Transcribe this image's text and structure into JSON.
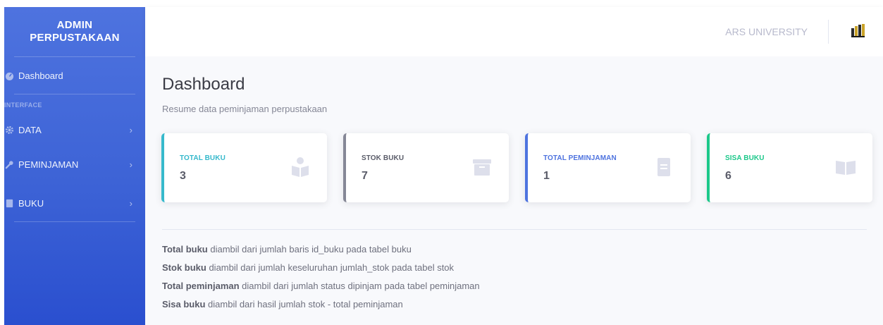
{
  "sidebar": {
    "brand_line1": "ADMIN",
    "brand_line2": "PERPUSTAKAAN",
    "dashboard_label": "Dashboard",
    "heading": "INTERFACE",
    "items": [
      {
        "label": "DATA",
        "icon": "gear-icon"
      },
      {
        "label": "PEMINJAMAN",
        "icon": "wrench-icon"
      },
      {
        "label": "BUKU",
        "icon": "book-icon"
      }
    ]
  },
  "topbar": {
    "university": "ARS UNIVERSITY",
    "logo": "university-logo"
  },
  "main": {
    "title": "Dashboard",
    "subtitle": "Resume data peminjaman perpustakaan",
    "cards": [
      {
        "label": "TOTAL BUKU",
        "value": "3",
        "accent": "#36b9cc",
        "icon": "reader-icon"
      },
      {
        "label": "STOK BUKU",
        "value": "7",
        "accent": "#858796",
        "icon": "archive-icon"
      },
      {
        "label": "TOTAL PEMINJAMAN",
        "value": "1",
        "accent": "#4e73df",
        "icon": "book-icon"
      },
      {
        "label": "SISA BUKU",
        "value": "6",
        "accent": "#1cc88a",
        "icon": "open-book-icon"
      }
    ],
    "notes": [
      {
        "bold": "Total buku",
        "text": " diambil dari jumlah baris id_buku pada tabel buku"
      },
      {
        "bold": "Stok buku",
        "text": " diambil dari jumlah keseluruhan jumlah_stok pada tabel stok"
      },
      {
        "bold": "Total peminjaman",
        "text": " diambil dari jumlah status dipinjam pada tabel peminjaman"
      },
      {
        "bold": "Sisa buku",
        "text": " diambil dari hasil jumlah stok - total peminjaman"
      }
    ]
  },
  "colors": {
    "sidebar": "#4e73df",
    "label_blue": "#4e73df",
    "label_teal": "#36b9cc",
    "label_gray": "#5a5c69",
    "label_green": "#1cc88a"
  }
}
